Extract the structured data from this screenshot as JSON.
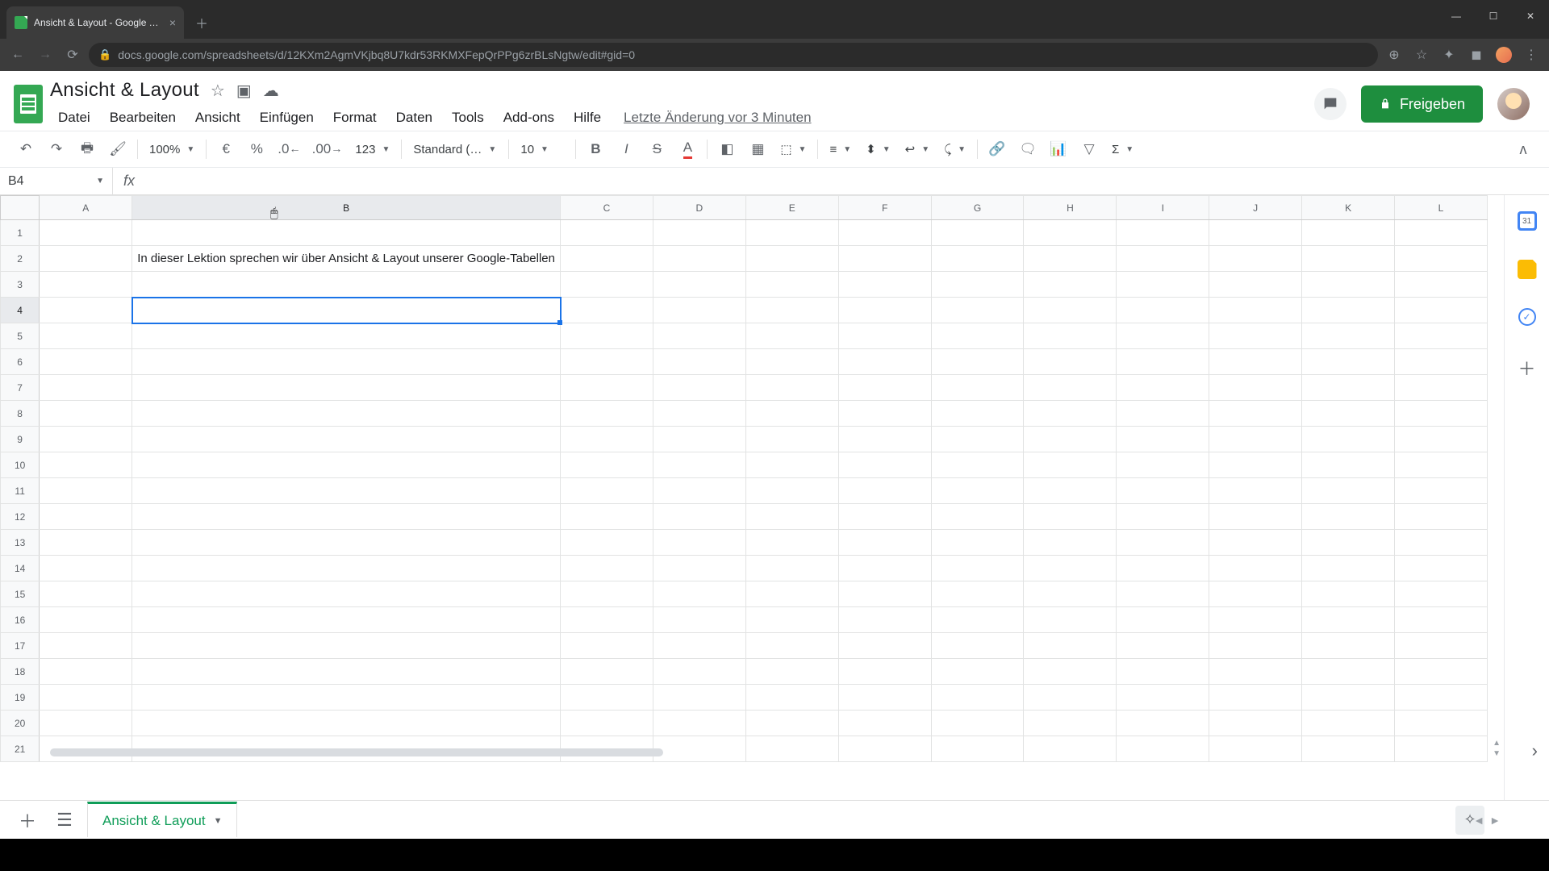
{
  "browser": {
    "tab_title": "Ansicht & Layout - Google Tabel",
    "url": "docs.google.com/spreadsheets/d/12KXm2AgmVKjbq8U7kdr53RKMXFepQrPPg6zrBLsNgtw/edit#gid=0"
  },
  "doc": {
    "title": "Ansicht & Layout",
    "last_edit": "Letzte Änderung vor 3 Minuten",
    "share_label": "Freigeben"
  },
  "menus": [
    "Datei",
    "Bearbeiten",
    "Ansicht",
    "Einfügen",
    "Format",
    "Daten",
    "Tools",
    "Add-ons",
    "Hilfe"
  ],
  "toolbar": {
    "zoom": "100%",
    "currency": "€",
    "percent": "%",
    "dec_dec": ".0",
    "inc_dec": ".00",
    "more_formats": "123",
    "font": "Standard (…",
    "font_size": "10"
  },
  "formula": {
    "name_box": "B4",
    "fx": "fx",
    "value": ""
  },
  "grid": {
    "columns": [
      "A",
      "B",
      "C",
      "D",
      "E",
      "F",
      "G",
      "H",
      "I",
      "J",
      "K",
      "L"
    ],
    "rows": 21,
    "selected": "B4",
    "cells": {
      "B2": "In dieser Lektion sprechen wir über Ansicht & Layout unserer Google-Tabellen"
    }
  },
  "sheet_tab": "Ansicht & Layout"
}
